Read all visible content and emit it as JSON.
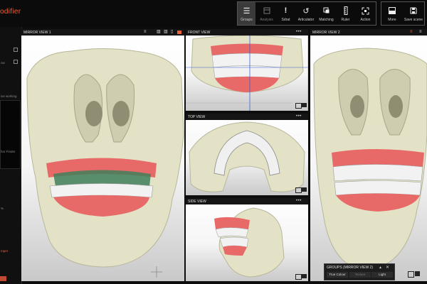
{
  "app": {
    "title": "odifier"
  },
  "toolbar": {
    "groups": "Groups",
    "analysis": "Analysis",
    "sdrat": "Sdrat",
    "articulator": "Articulator",
    "matching": "Matching",
    "ruler": "Ruler",
    "action": "Action",
    "more": "More",
    "save_scene": "Save scene"
  },
  "left_panel": {
    "label_1": "ow",
    "label_2": "ive working",
    "label_3": "hor Finder",
    "label_4": "%",
    "label_5": "mper"
  },
  "viewports": {
    "mirror1": {
      "title": "MIRROR VIEW 1"
    },
    "front": {
      "title": "FRONT VIEW"
    },
    "top": {
      "title": "TOP VIEW"
    },
    "side": {
      "title": "SIDE VIEW"
    },
    "mirror2": {
      "title": "MIRROR VIEW 2"
    }
  },
  "groups_panel": {
    "title": "GROUPS (MIRROR VIEW 2)",
    "true_colour": "True Colour",
    "texture": "Texture",
    "light": "Light"
  },
  "icons": [
    "menu-icon",
    "analysis-icon",
    "exclamation-icon",
    "undo-icon",
    "matching-icon",
    "ruler-icon",
    "target-icon",
    "more-icon",
    "save-icon"
  ],
  "colors": {
    "accent": "#e8613a",
    "gum": "#e86a68",
    "bone": "#e3e2c7",
    "guide": "#3f7f5a"
  }
}
